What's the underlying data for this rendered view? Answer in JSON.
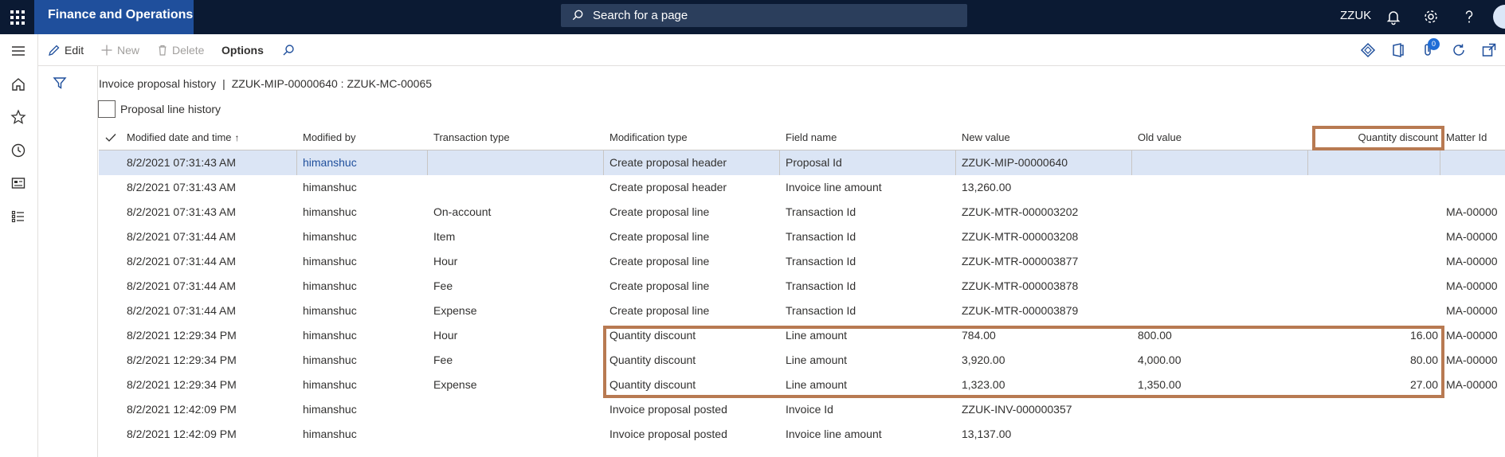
{
  "topbar": {
    "app_title": "Finance and Operations",
    "search_placeholder": "Search for a page",
    "company": "ZZUK"
  },
  "actions": {
    "edit": "Edit",
    "new": "New",
    "delete": "Delete",
    "options": "Options",
    "badge_count": "0"
  },
  "page": {
    "form_name": "Invoice proposal history",
    "separator": "|",
    "record_caption": "ZZUK-MIP-00000640 : ZZUK-MC-00065",
    "checkbox_label": "Proposal line history"
  },
  "grid": {
    "columns": [
      "Modified date and time",
      "Modified by",
      "Transaction type",
      "Modification type",
      "Field name",
      "New value",
      "Old value",
      "Quantity discount",
      "Matter Id"
    ],
    "rows": [
      [
        "8/2/2021 07:31:43 AM",
        "himanshuc",
        "",
        "Create proposal header",
        "Proposal Id",
        "ZZUK-MIP-00000640",
        "",
        "",
        ""
      ],
      [
        "8/2/2021 07:31:43 AM",
        "himanshuc",
        "",
        "Create proposal header",
        "Invoice line amount",
        "13,260.00",
        "",
        "",
        ""
      ],
      [
        "8/2/2021 07:31:43 AM",
        "himanshuc",
        "On-account",
        "Create proposal line",
        "Transaction Id",
        "ZZUK-MTR-000003202",
        "",
        "",
        "MA-00000"
      ],
      [
        "8/2/2021 07:31:44 AM",
        "himanshuc",
        "Item",
        "Create proposal line",
        "Transaction Id",
        "ZZUK-MTR-000003208",
        "",
        "",
        "MA-00000"
      ],
      [
        "8/2/2021 07:31:44 AM",
        "himanshuc",
        "Hour",
        "Create proposal line",
        "Transaction Id",
        "ZZUK-MTR-000003877",
        "",
        "",
        "MA-00000"
      ],
      [
        "8/2/2021 07:31:44 AM",
        "himanshuc",
        "Fee",
        "Create proposal line",
        "Transaction Id",
        "ZZUK-MTR-000003878",
        "",
        "",
        "MA-00000"
      ],
      [
        "8/2/2021 07:31:44 AM",
        "himanshuc",
        "Expense",
        "Create proposal line",
        "Transaction Id",
        "ZZUK-MTR-000003879",
        "",
        "",
        "MA-00000"
      ],
      [
        "8/2/2021 12:29:34 PM",
        "himanshuc",
        "Hour",
        "Quantity discount",
        "Line amount",
        "784.00",
        "800.00",
        "16.00",
        "MA-00000"
      ],
      [
        "8/2/2021 12:29:34 PM",
        "himanshuc",
        "Fee",
        "Quantity discount",
        "Line amount",
        "3,920.00",
        "4,000.00",
        "80.00",
        "MA-00000"
      ],
      [
        "8/2/2021 12:29:34 PM",
        "himanshuc",
        "Expense",
        "Quantity discount",
        "Line amount",
        "1,323.00",
        "1,350.00",
        "27.00",
        "MA-00000"
      ],
      [
        "8/2/2021 12:42:09 PM",
        "himanshuc",
        "",
        "Invoice proposal posted",
        "Invoice Id",
        "ZZUK-INV-000000357",
        "",
        "",
        ""
      ],
      [
        "8/2/2021 12:42:09 PM",
        "himanshuc",
        "",
        "Invoice proposal posted",
        "Invoice line amount",
        "13,137.00",
        "",
        "",
        ""
      ]
    ]
  },
  "colors": {
    "topbar": "#0b1a33",
    "app_title_bg": "#1f4f9c",
    "selected_row": "#dbe5f5",
    "highlight_border": "#b87a52"
  }
}
